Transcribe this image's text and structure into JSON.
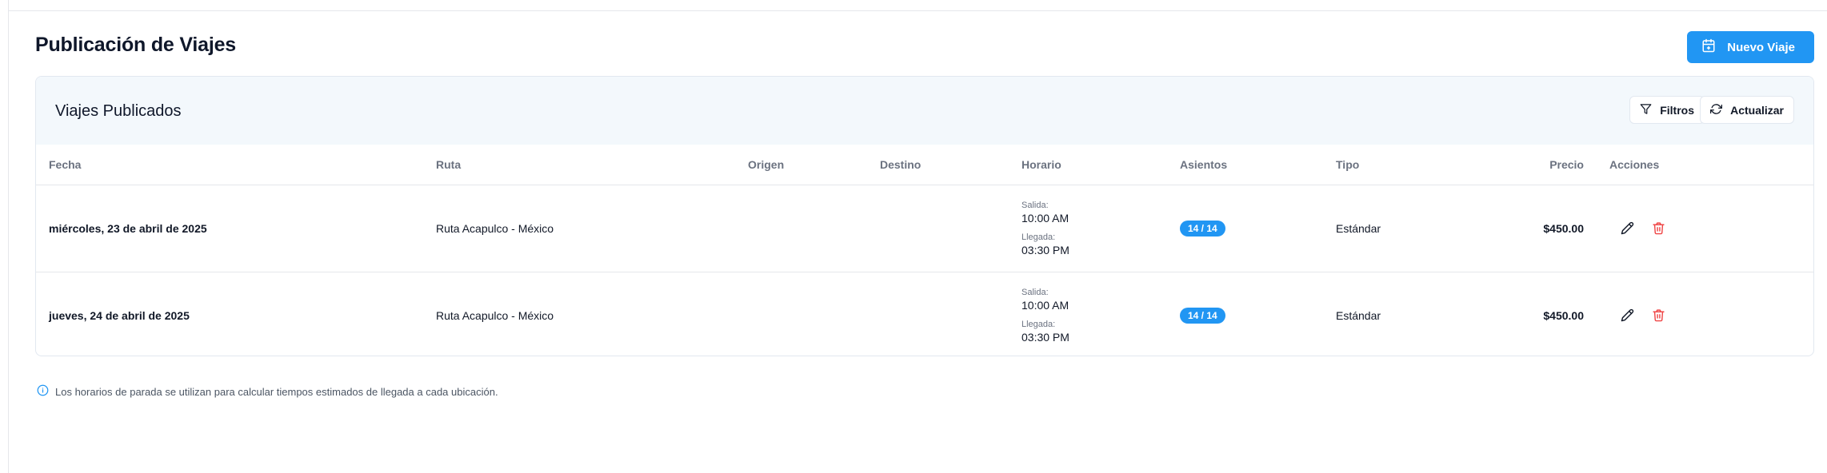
{
  "page": {
    "title": "Publicación de Viajes"
  },
  "actions": {
    "new_trip_label": "Nuevo Viaje"
  },
  "card": {
    "title": "Viajes Publicados",
    "filter_label": "Filtros",
    "refresh_label": "Actualizar"
  },
  "table": {
    "headers": {
      "fecha": "Fecha",
      "ruta": "Ruta",
      "origen": "Origen",
      "destino": "Destino",
      "horario": "Horario",
      "asientos": "Asientos",
      "tipo": "Tipo",
      "precio": "Precio",
      "acciones": "Acciones"
    },
    "rows": [
      {
        "fecha": "miércoles, 23 de abril de 2025",
        "ruta": "Ruta Acapulco - México",
        "origen": "",
        "destino": "",
        "salida_label": "Salida:",
        "salida": "10:00 AM",
        "llegada_label": "Llegada:",
        "llegada": "03:30 PM",
        "asientos": "14 / 14",
        "tipo": "Estándar",
        "precio": "$450.00"
      },
      {
        "fecha": "jueves, 24 de abril de 2025",
        "ruta": "Ruta Acapulco - México",
        "origen": "",
        "destino": "",
        "salida_label": "Salida:",
        "salida": "10:00 AM",
        "llegada_label": "Llegada:",
        "llegada": "03:30 PM",
        "asientos": "14 / 14",
        "tipo": "Estándar",
        "precio": "$450.00"
      }
    ]
  },
  "info_note": "Los horarios de parada se utilizan para calcular tiempos estimados de llegada a cada ubicación.",
  "icons": {
    "new_trip": "calendar-plus-icon",
    "filter": "filter-icon",
    "refresh": "refresh-icon",
    "edit": "pencil-icon",
    "delete": "trash-icon",
    "info": "info-icon"
  },
  "colors": {
    "primary": "#2196f3",
    "danger": "#ef4444",
    "header_bg": "#f3f8fc"
  }
}
